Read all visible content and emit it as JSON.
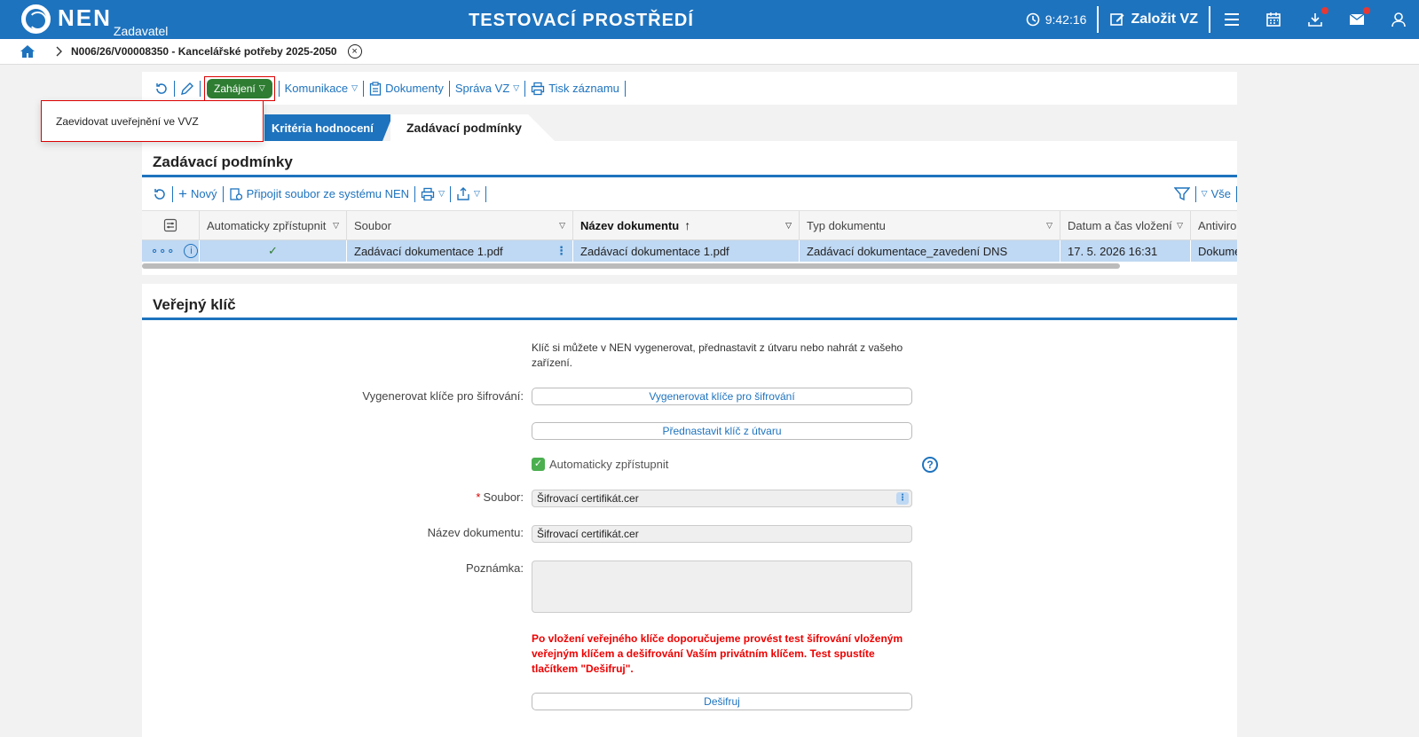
{
  "header": {
    "logo": "NEN",
    "logo_sub": "Zadavatel",
    "env_title": "TESTOVACÍ PROSTŘEDÍ",
    "clock": "9:42:16",
    "create_label": "Založit VZ"
  },
  "breadcrumb": {
    "current": "N006/26/V00008350 - Kancelářské potřeby 2025-2050",
    "close": "⊗"
  },
  "toolbar": {
    "zahajeni": "Zahájení",
    "komunikace": "Komunikace",
    "dokumenty": "Dokumenty",
    "sprava": "Správa VZ",
    "tisk": "Tisk záznamu"
  },
  "dropdown": {
    "item": "Zaevidovat uveřejnění ve VVZ"
  },
  "tabs": {
    "criteria": "Kritéria hodnocení",
    "active": "Zadávací podmínky"
  },
  "section1": {
    "title": "Zadávací podmínky",
    "new": "Nový",
    "attach": "Připojit soubor ze systému NEN",
    "all": "Vše",
    "columns": [
      "Automaticky zpřístupnit",
      "Soubor",
      "Název dokumentu",
      "Typ dokumentu",
      "Datum a čas vložení",
      "Antiviro"
    ],
    "row": {
      "auto": "✓",
      "file": "Zadávací dokumentace 1.pdf",
      "name": "Zadávací dokumentace 1.pdf",
      "type": "Zadávací dokumentace_zavedení DNS",
      "date": "17. 5. 2026 16:31",
      "antivirus": "Dokume"
    }
  },
  "section2": {
    "title": "Veřejný klíč",
    "info": "Klíč si můžete v NEN vygenerovat, přednastavit z útvaru nebo nahrát z vašeho zařízení.",
    "gen_label": "Vygenerovat klíče pro šifrování:",
    "gen_button": "Vygenerovat klíče pro šifrování",
    "preset_button": "Přednastavit klíč z útvaru",
    "auto_label": "Automaticky zpřístupnit",
    "help": "?",
    "file_label": "Soubor:",
    "file_value": "Šifrovací certifikát.cer",
    "name_label": "Název dokumentu:",
    "name_value": "Šifrovací certifikát.cer",
    "note_label": "Poznámka:",
    "warning": "Po vložení veřejného klíče doporučujeme provést test šifrování vloženým veřejným klíčem a dešifrování Vaším privátním klíčem. Test spustíte tlačítkem \"Dešifruj\".",
    "decrypt_button": "Dešifruj"
  },
  "colors": {
    "brand": "#1e73be",
    "start_button": "#2e7d32",
    "warning": "#e00000",
    "selected_row": "#bfd8f3"
  }
}
